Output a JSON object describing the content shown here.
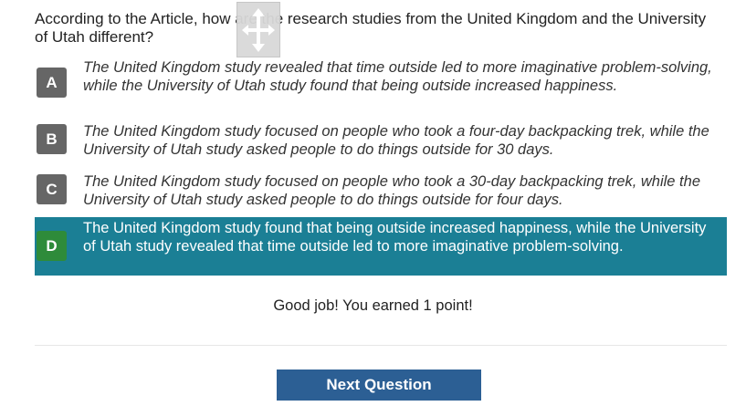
{
  "question": {
    "text": "According to the Article, how are the research studies from the United Kingdom and the University of Utah different?"
  },
  "choices": [
    {
      "letter": "A",
      "text": "The United Kingdom study revealed that time outside led to more imaginative problem-solving, while the University of Utah study found that being outside increased happiness.",
      "selected": false
    },
    {
      "letter": "B",
      "text": "The United Kingdom study focused on people who took a four-day backpacking trek, while the University of Utah study asked people to do things outside for 30 days.",
      "selected": false
    },
    {
      "letter": "C",
      "text": "The United Kingdom study focused on people who took a 30-day backpacking trek, while the University of Utah study asked people to do things outside for four days.",
      "selected": false
    },
    {
      "letter": "D",
      "text": "The United Kingdom study found that being outside increased happiness, while the University of Utah study revealed that time outside led to more imaginative problem-solving.",
      "selected": true
    }
  ],
  "feedback": "Good job! You earned 1 point!",
  "next_button_label": "Next Question",
  "icons": {
    "move_handle": "move-arrows-icon"
  },
  "colors": {
    "selected_background": "#1b7f95",
    "selected_letter": "#2e8b3a",
    "letter_default": "#666666",
    "button": "#2c5f94"
  }
}
